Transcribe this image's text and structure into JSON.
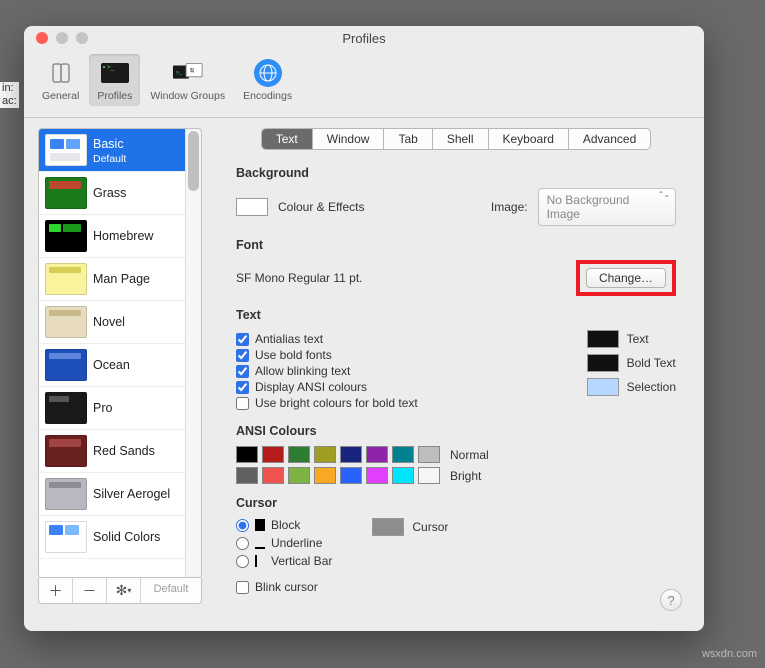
{
  "window": {
    "title": "Profiles"
  },
  "toolbar": {
    "general": "General",
    "profiles": "Profiles",
    "groups": "Window Groups",
    "encodings": "Encodings"
  },
  "sidebar": {
    "items": [
      {
        "label": "Basic",
        "sub": "Default"
      },
      {
        "label": "Grass"
      },
      {
        "label": "Homebrew"
      },
      {
        "label": "Man Page"
      },
      {
        "label": "Novel"
      },
      {
        "label": "Ocean"
      },
      {
        "label": "Pro"
      },
      {
        "label": "Red Sands"
      },
      {
        "label": "Silver Aerogel"
      },
      {
        "label": "Solid Colors"
      }
    ],
    "default": "Default"
  },
  "tabs": [
    "Text",
    "Window",
    "Tab",
    "Shell",
    "Keyboard",
    "Advanced"
  ],
  "background": {
    "heading": "Background",
    "colour_effects": "Colour & Effects",
    "image_label": "Image:",
    "image_value": "No Background Image"
  },
  "font": {
    "heading": "Font",
    "desc": "SF Mono Regular 11 pt.",
    "change": "Change…"
  },
  "text": {
    "heading": "Text",
    "antialias": "Antialias text",
    "use_bold": "Use bold fonts",
    "blinking": "Allow blinking text",
    "ansi": "Display ANSI colours",
    "bright_bold": "Use bright colours for bold text",
    "swatch_text": "Text",
    "swatch_bold": "Bold Text",
    "swatch_sel": "Selection"
  },
  "ansi": {
    "heading": "ANSI Colours",
    "normal": "Normal",
    "bright": "Bright",
    "normal_colors": [
      "#000000",
      "#b71c1c",
      "#2e7d32",
      "#9e9d24",
      "#1a237e",
      "#8e24aa",
      "#00838f",
      "#bdbdbd"
    ],
    "bright_colors": [
      "#616161",
      "#ef5350",
      "#7cb342",
      "#f9a825",
      "#2962ff",
      "#e040fb",
      "#00e5ff",
      "#f5f5f5"
    ]
  },
  "cursor": {
    "heading": "Cursor",
    "block": "Block",
    "underline": "Underline",
    "vbar": "Vertical Bar",
    "blink": "Blink cursor",
    "swatch": "Cursor"
  },
  "outside": {
    "line1": "in:",
    "line2": "ac:"
  },
  "watermark": "wsxdn.com"
}
